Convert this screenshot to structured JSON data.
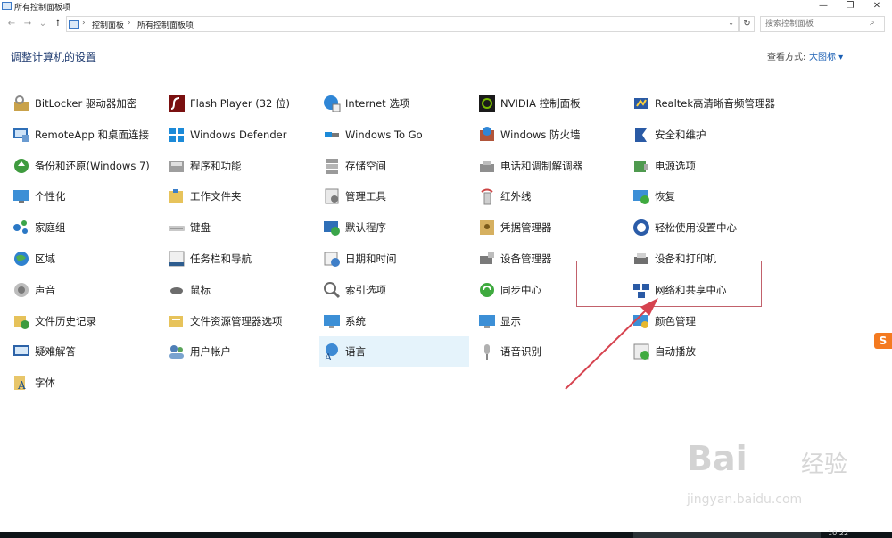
{
  "window": {
    "title": "所有控制面板项",
    "minimize": "—",
    "maximize": "❐",
    "close": "✕"
  },
  "address": {
    "back": "←",
    "forward": "→",
    "dropdown": "⌄",
    "up": "↑",
    "crumbs": [
      "控制面板",
      "所有控制面板项"
    ],
    "separator": "›",
    "refresh": "↻",
    "search_placeholder": "搜索控制面板"
  },
  "header": {
    "title": "调整计算机的设置",
    "view_by_label": "查看方式:",
    "view_by_value": "大图标 ▾"
  },
  "items": [
    {
      "label": "BitLocker 驱动器加密",
      "icon": "bitlocker-icon"
    },
    {
      "label": "RemoteApp 和桌面连接",
      "icon": "remoteapp-icon"
    },
    {
      "label": "备份和还原(Windows 7)",
      "icon": "backup-icon"
    },
    {
      "label": "个性化",
      "icon": "personalization-icon"
    },
    {
      "label": "家庭组",
      "icon": "homegroup-icon"
    },
    {
      "label": "区域",
      "icon": "region-icon"
    },
    {
      "label": "声音",
      "icon": "sound-icon"
    },
    {
      "label": "文件历史记录",
      "icon": "file-history-icon"
    },
    {
      "label": "疑难解答",
      "icon": "troubleshooting-icon"
    },
    {
      "label": "字体",
      "icon": "fonts-icon"
    },
    {
      "label": "Flash Player (32 位)",
      "icon": "flash-icon"
    },
    {
      "label": "Windows Defender",
      "icon": "defender-icon"
    },
    {
      "label": "程序和功能",
      "icon": "programs-icon"
    },
    {
      "label": "工作文件夹",
      "icon": "work-folders-icon"
    },
    {
      "label": "键盘",
      "icon": "keyboard-icon"
    },
    {
      "label": "任务栏和导航",
      "icon": "taskbar-icon"
    },
    {
      "label": "鼠标",
      "icon": "mouse-icon"
    },
    {
      "label": "文件资源管理器选项",
      "icon": "explorer-options-icon"
    },
    {
      "label": "用户帐户",
      "icon": "user-accounts-icon"
    },
    {
      "label": "Internet 选项",
      "icon": "internet-options-icon"
    },
    {
      "label": "Windows To Go",
      "icon": "windows-to-go-icon"
    },
    {
      "label": "存储空间",
      "icon": "storage-spaces-icon"
    },
    {
      "label": "管理工具",
      "icon": "admin-tools-icon"
    },
    {
      "label": "默认程序",
      "icon": "default-programs-icon"
    },
    {
      "label": "日期和时间",
      "icon": "date-time-icon"
    },
    {
      "label": "索引选项",
      "icon": "indexing-icon"
    },
    {
      "label": "系统",
      "icon": "system-icon"
    },
    {
      "label": "语言",
      "icon": "language-icon"
    },
    {
      "label": "NVIDIA 控制面板",
      "icon": "nvidia-icon"
    },
    {
      "label": "Windows 防火墙",
      "icon": "firewall-icon"
    },
    {
      "label": "电话和调制解调器",
      "icon": "phone-modem-icon"
    },
    {
      "label": "红外线",
      "icon": "infrared-icon"
    },
    {
      "label": "凭据管理器",
      "icon": "credential-icon"
    },
    {
      "label": "设备管理器",
      "icon": "device-manager-icon"
    },
    {
      "label": "同步中心",
      "icon": "sync-center-icon"
    },
    {
      "label": "显示",
      "icon": "display-icon"
    },
    {
      "label": "语音识别",
      "icon": "speech-icon"
    },
    {
      "label": "Realtek高清晰音频管理器",
      "icon": "realtek-icon"
    },
    {
      "label": "安全和维护",
      "icon": "security-maintenance-icon"
    },
    {
      "label": "电源选项",
      "icon": "power-icon"
    },
    {
      "label": "恢复",
      "icon": "recovery-icon"
    },
    {
      "label": "轻松使用设置中心",
      "icon": "ease-of-access-icon"
    },
    {
      "label": "设备和打印机",
      "icon": "devices-printers-icon"
    },
    {
      "label": "网络和共享中心",
      "icon": "network-sharing-icon"
    },
    {
      "label": "颜色管理",
      "icon": "color-management-icon"
    },
    {
      "label": "自动播放",
      "icon": "autoplay-icon"
    }
  ],
  "selected_item": "语言",
  "annotation": {
    "color": "#d6434f"
  },
  "sogou": {
    "label": "S"
  },
  "watermark": {
    "main": "Bai",
    "cn": "经验",
    "url": "jingyan.baidu.com"
  },
  "taskbar": {
    "clock": "10:22"
  },
  "colors": {
    "accent": "#1a5fb4",
    "heading": "#1f3b70",
    "selection": "#e5f3fb"
  }
}
